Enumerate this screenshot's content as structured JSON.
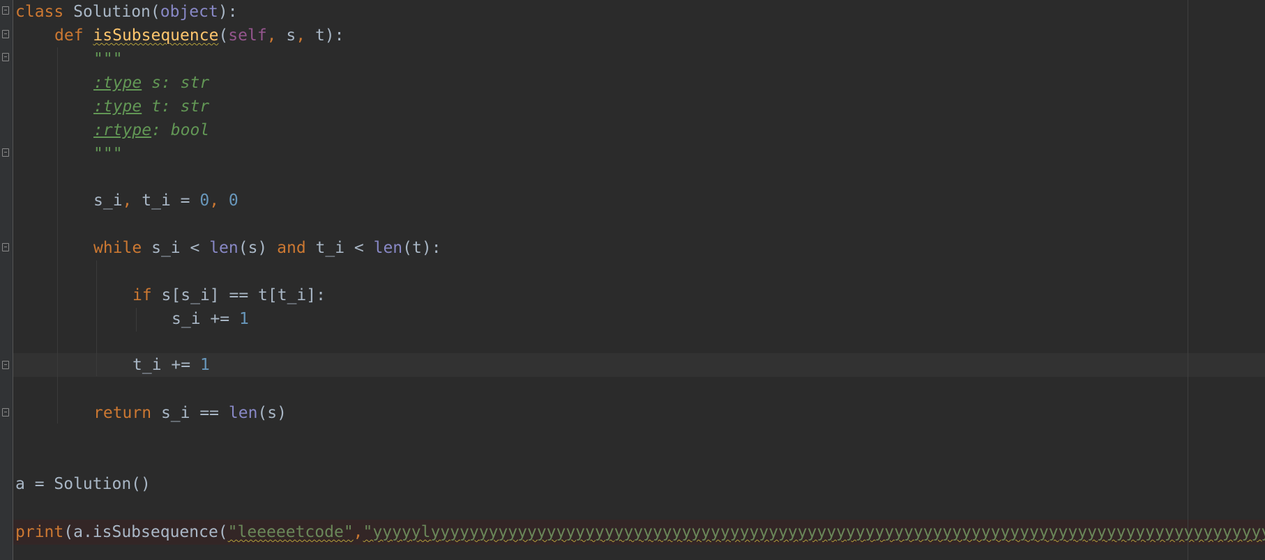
{
  "editor": {
    "language": "python",
    "lines": {
      "l1": {
        "kw_class": "class",
        "name": "Solution",
        "paren_open": "(",
        "base": "object",
        "paren_close": "):"
      },
      "l2": {
        "kw_def": "def",
        "fn": "isSubsequence",
        "p_open": "(",
        "self": "self",
        "sep1": ",",
        "arg_s": " s",
        "sep2": ",",
        "arg_t": " t",
        "p_close": "):"
      },
      "l3": {
        "text": "\"\"\""
      },
      "l4": {
        "tag": ":type",
        "rest": " s: str"
      },
      "l5": {
        "tag": ":type",
        "rest": " t: str"
      },
      "l6": {
        "tag": ":rtype",
        "rest": ": bool"
      },
      "l7": {
        "text": "\"\"\""
      },
      "l8": {
        "lhs": "s_i",
        "comma": ",",
        "lhs2": " t_i = ",
        "n1": "0",
        "comma2": ",",
        "n2": " 0"
      },
      "l9": {
        "kw_while": "while",
        "a": " s_i < ",
        "len1": "len",
        "b": "(s) ",
        "kw_and": "and",
        "c": " t_i < ",
        "len2": "len",
        "d": "(t):"
      },
      "l10": {
        "kw_if": "if",
        "rest": " s[s_i] == t[t_i]:"
      },
      "l11": {
        "lhs": "s_i += ",
        "n": "1"
      },
      "l12": {
        "lhs": "t_i += ",
        "n": "1"
      },
      "l13": {
        "kw_return": "return",
        "a": " s_i == ",
        "len": "len",
        "b": "(s)"
      },
      "l14": {
        "text": "a = Solution()"
      },
      "l15": {
        "print": "print",
        "a": "(a.isSubsequence(",
        "s1": "\"leeeeetcode\"",
        "comma": ",",
        "s2": "\"yyyyylyyyyyyyyyyyyyyyyyyyyyyyyyyyyyyyyyyyyyyyyyyyyyyyyyyyyyyyyyyyyyyyyyyyyyyyyyyyyyyyyyyyyyyyyyyyyyyyyyyyy"
      }
    },
    "colors": {
      "background": "#2b2b2b",
      "keyword": "#cc7832",
      "function": "#ffc66d",
      "self": "#94558d",
      "builtin": "#8888c6",
      "number": "#6897bb",
      "string": "#6a8759",
      "docstring": "#629755",
      "text": "#a9b7c6"
    }
  }
}
